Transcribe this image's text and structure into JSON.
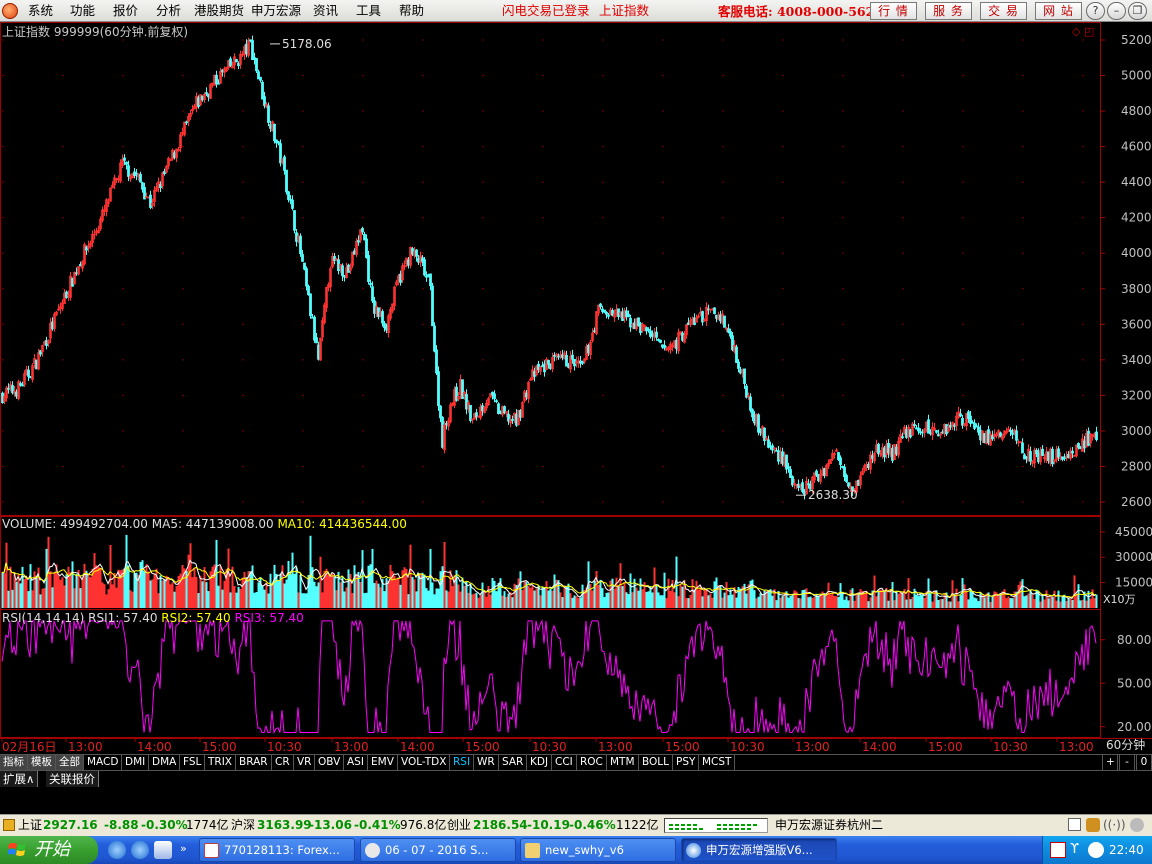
{
  "menu": {
    "items": [
      "系统",
      "功能",
      "报价",
      "分析",
      "港股期货",
      "申万宏源",
      "资讯",
      "工具",
      "帮助"
    ],
    "status_login": "闪电交易已登录",
    "status_index": "上证指数",
    "hotline": "客服电话: 4008-000-562",
    "nav_buttons": [
      "行 情",
      "服 务",
      "交 易",
      "网 站"
    ],
    "window_controls": [
      "?",
      "–",
      "❐",
      "✕"
    ]
  },
  "chart": {
    "title": "上证指数 999999(60分钟.前复权)",
    "price_axis_ticks": [
      "5200",
      "5000",
      "4800",
      "4600",
      "4400",
      "4200",
      "4000",
      "3800",
      "3600",
      "3400",
      "3200",
      "3000",
      "2800",
      "2600"
    ],
    "high_label": "5178.06",
    "low_label": "2638.30",
    "volume_label": {
      "name": "VOLUME:",
      "value": "499492704.00",
      "ma5": "MA5: 447139008.00",
      "ma10": "MA10: 414436544.00"
    },
    "volume_axis_ticks": [
      "45000",
      "30000",
      "15000"
    ],
    "volume_unit": "X10万",
    "rsi_label": {
      "name": "RSI(14,14,14)",
      "rsi1": "RSI1: 57.40",
      "rsi2": "RSI2: 57.40",
      "rsi3": "RSI3: 57.40"
    },
    "rsi_axis_ticks": [
      "80.00",
      "50.00",
      "20.00"
    ],
    "time_axis": [
      "02月16日",
      "13:00",
      "14:00",
      "15:00",
      "10:30",
      "13:00",
      "14:00",
      "15:00",
      "10:30",
      "13:00",
      "15:00",
      "10:30",
      "13:00",
      "14:00",
      "15:00",
      "10:30",
      "13:00"
    ],
    "period": "60分钟",
    "colors": {
      "up": "#ff3232",
      "down": "#54ffff",
      "ma5": "#ffffff",
      "ma10": "#ffff00",
      "rsi": "#ff00ff",
      "frame": "#a00000",
      "axis_text": "#c0c0c0"
    }
  },
  "indicators": {
    "tabs": [
      "指标",
      "模板",
      "全部"
    ],
    "items": [
      "MACD",
      "DMI",
      "DMA",
      "FSL",
      "TRIX",
      "BRAR",
      "CR",
      "VR",
      "OBV",
      "ASI",
      "EMV",
      "VOL-TDX",
      "RSI",
      "WR",
      "SAR",
      "KDJ",
      "CCI",
      "ROC",
      "MTM",
      "BOLL",
      "PSY",
      "MCST"
    ],
    "active": "RSI",
    "right_controls": [
      "+",
      "-",
      "0"
    ]
  },
  "extension_tabs": [
    "扩展∧",
    "关联报价"
  ],
  "status": {
    "sh": {
      "name": "上证",
      "value": "2927.16",
      "change": "-8.88",
      "pct": "-0.30%",
      "amount": "1774亿"
    },
    "hs": {
      "name": "沪深",
      "value": "3163.99",
      "change": "-13.06",
      "pct": "-0.41%",
      "amount": "976.8亿"
    },
    "cy": {
      "name": "创业",
      "value": "2186.54",
      "change": "-10.19",
      "pct": "-0.46%",
      "amount": "1122亿"
    },
    "broker": "申万宏源证券杭州二"
  },
  "taskbar": {
    "start": "开始",
    "tasks": [
      "770128113: Forex...",
      "06 - 07 - 2016 S...",
      "new_swhy_v6",
      "申万宏源增强版V6..."
    ],
    "clock": "22:40"
  }
}
